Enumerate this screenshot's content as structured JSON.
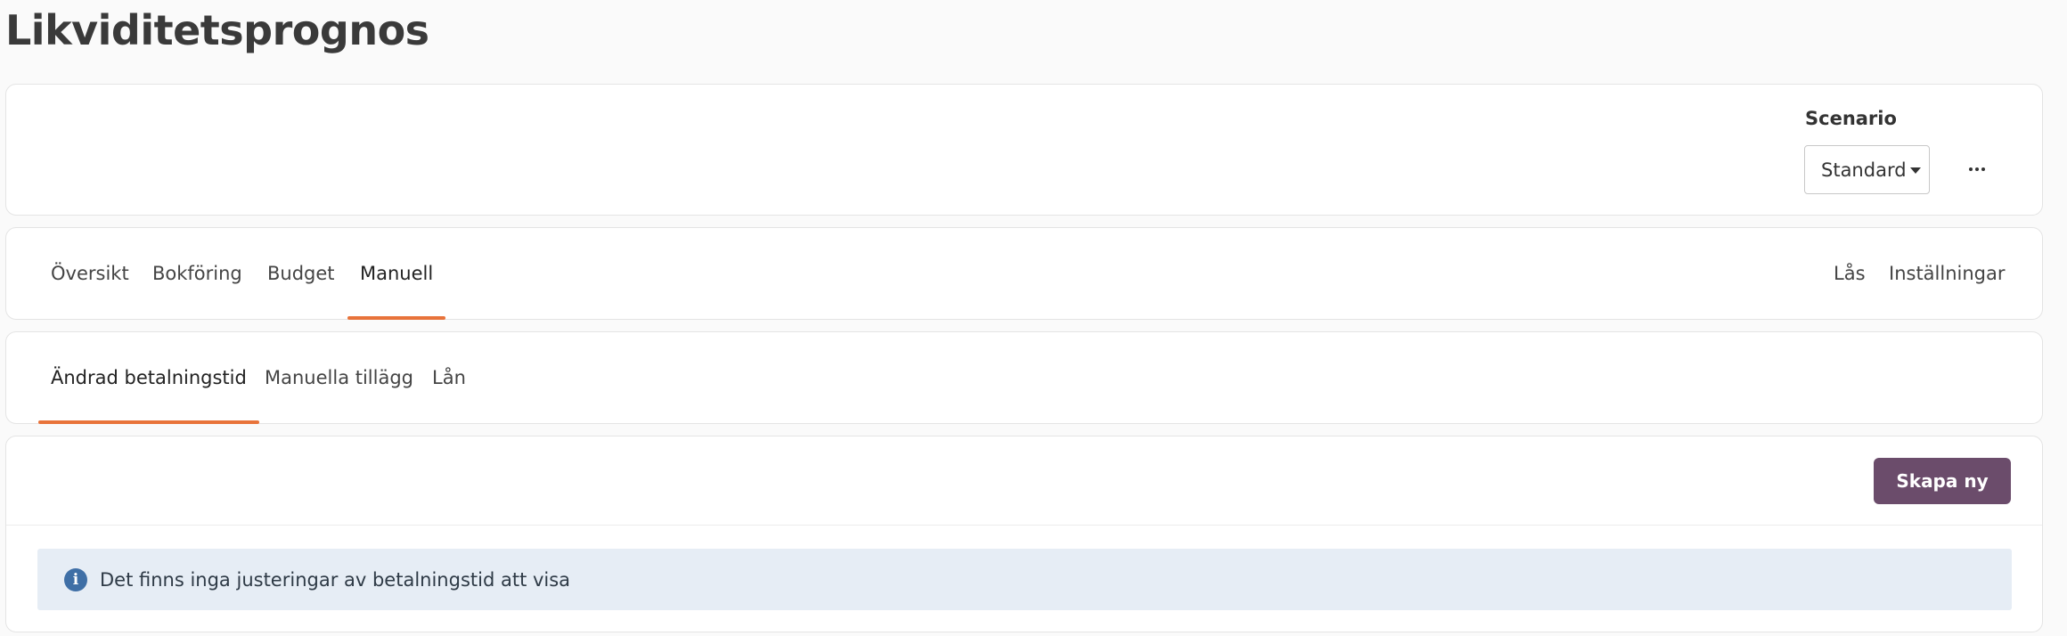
{
  "page": {
    "title": "Likviditetsprognos"
  },
  "scenario": {
    "label": "Scenario",
    "selected": "Standard",
    "more_icon": "ellipsis-icon"
  },
  "tabs": {
    "items": [
      {
        "label": "Översikt",
        "active": false
      },
      {
        "label": "Bokföring",
        "active": false
      },
      {
        "label": "Budget",
        "active": false
      },
      {
        "label": "Manuell",
        "active": true
      }
    ],
    "right_items": [
      {
        "label": "Lås"
      },
      {
        "label": "Inställningar"
      }
    ]
  },
  "subtabs": {
    "items": [
      {
        "label": "Ändrad betalningstid",
        "active": true
      },
      {
        "label": "Manuella tillägg",
        "active": false
      },
      {
        "label": "Lån",
        "active": false
      }
    ]
  },
  "content": {
    "create_button_label": "Skapa ny",
    "info_icon": "info-circle-icon",
    "info_glyph": "i",
    "info_message": "Det finns inga justeringar av betalningstid att visa"
  },
  "colors": {
    "accent": "#e8733a",
    "primary_button": "#6b4c6b",
    "info_background": "#e6edf5",
    "info_icon": "#3f6fa6"
  }
}
